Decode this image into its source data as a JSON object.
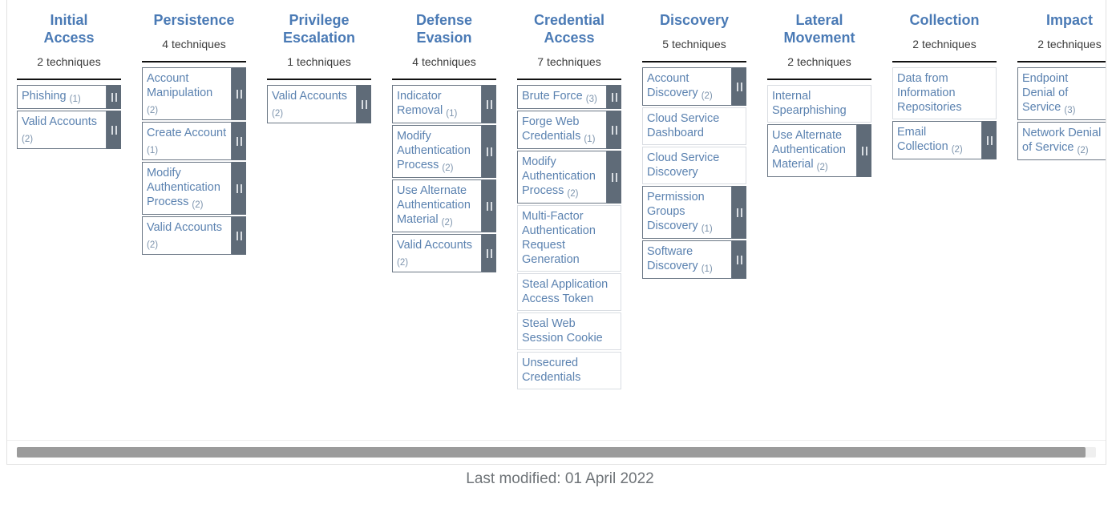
{
  "footer": {
    "last_modified": "Last modified: 01 April 2022"
  },
  "scrollbar": {
    "name": "horizontal-scrollbar"
  },
  "colors": {
    "tactic_title": "#4a7ab5",
    "technique_text": "#5b82b0",
    "subtechnique_bar": "#5f6b78",
    "cell_border_with_subs": "#6b7785",
    "cell_border_plain": "#d9dde2",
    "footer_text": "#6f7478",
    "scroll_thumb": "#9b9b9b"
  },
  "tactics": [
    {
      "name": "Initial\nAccess",
      "count": "2 techniques",
      "techniques": [
        {
          "name": "Phishing",
          "subs": "(1)",
          "has_subs": true
        },
        {
          "name": "Valid Accounts",
          "subs": "(2)",
          "has_subs": true
        }
      ]
    },
    {
      "name": "Persistence",
      "count": "4 techniques",
      "techniques": [
        {
          "name": "Account Manipulation",
          "subs": "(2)",
          "has_subs": true
        },
        {
          "name": "Create Account",
          "subs": "(1)",
          "has_subs": true
        },
        {
          "name": "Modify Authentication Process",
          "subs": "(2)",
          "has_subs": true
        },
        {
          "name": "Valid Accounts",
          "subs": "(2)",
          "has_subs": true
        }
      ]
    },
    {
      "name": "Privilege\nEscalation",
      "count": "1 techniques",
      "techniques": [
        {
          "name": "Valid Accounts",
          "subs": "(2)",
          "has_subs": true
        }
      ]
    },
    {
      "name": "Defense\nEvasion",
      "count": "4 techniques",
      "techniques": [
        {
          "name": "Indicator Removal",
          "subs": "(1)",
          "has_subs": true
        },
        {
          "name": "Modify Authentication Process",
          "subs": "(2)",
          "has_subs": true
        },
        {
          "name": "Use Alternate Authentication Material",
          "subs": "(2)",
          "has_subs": true
        },
        {
          "name": "Valid Accounts",
          "subs": "(2)",
          "has_subs": true
        }
      ]
    },
    {
      "name": "Credential\nAccess",
      "count": "7 techniques",
      "techniques": [
        {
          "name": "Brute Force",
          "subs": "(3)",
          "has_subs": true
        },
        {
          "name": "Forge Web Credentials",
          "subs": "(1)",
          "has_subs": true
        },
        {
          "name": "Modify Authentication Process",
          "subs": "(2)",
          "has_subs": true
        },
        {
          "name": "Multi-Factor Authentication Request Generation",
          "subs": "",
          "has_subs": false
        },
        {
          "name": "Steal Application Access Token",
          "subs": "",
          "has_subs": false
        },
        {
          "name": "Steal Web Session Cookie",
          "subs": "",
          "has_subs": false
        },
        {
          "name": "Unsecured Credentials",
          "subs": "",
          "has_subs": false
        }
      ]
    },
    {
      "name": "Discovery",
      "count": "5 techniques",
      "techniques": [
        {
          "name": "Account Discovery",
          "subs": "(2)",
          "has_subs": true
        },
        {
          "name": "Cloud Service Dashboard",
          "subs": "",
          "has_subs": false
        },
        {
          "name": "Cloud Service Discovery",
          "subs": "",
          "has_subs": false
        },
        {
          "name": "Permission Groups Discovery",
          "subs": "(1)",
          "has_subs": true
        },
        {
          "name": "Software Discovery",
          "subs": "(1)",
          "has_subs": true
        }
      ]
    },
    {
      "name": "Lateral\nMovement",
      "count": "2 techniques",
      "techniques": [
        {
          "name": "Internal Spearphishing",
          "subs": "",
          "has_subs": false
        },
        {
          "name": "Use Alternate Authentication Material",
          "subs": "(2)",
          "has_subs": true
        }
      ]
    },
    {
      "name": "Collection",
      "count": "2 techniques",
      "techniques": [
        {
          "name": "Data from Information Repositories",
          "subs": "",
          "has_subs": false
        },
        {
          "name": "Email Collection",
          "subs": "(2)",
          "has_subs": true
        }
      ]
    },
    {
      "name": "Impact",
      "count": "2 techniques",
      "techniques": [
        {
          "name": "Endpoint Denial of Service",
          "subs": "(3)",
          "has_subs": true
        },
        {
          "name": "Network Denial of Service",
          "subs": "(2)",
          "has_subs": true
        }
      ]
    }
  ]
}
